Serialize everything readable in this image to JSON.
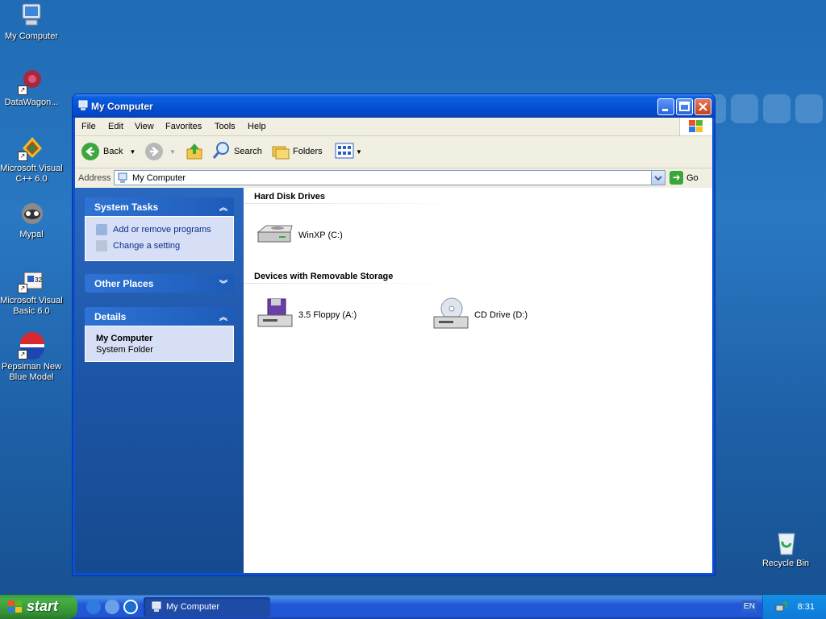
{
  "desktop": {
    "icons": [
      {
        "label": "My Computer"
      },
      {
        "label": "DataWagon..."
      },
      {
        "label": "Microsoft Visual C++ 6.0"
      },
      {
        "label": "Mypal"
      },
      {
        "label": "Microsoft Visual Basic 6.0"
      },
      {
        "label": "Pepsiman New Blue Model"
      },
      {
        "label": "Recycle Bin"
      }
    ]
  },
  "window": {
    "title": "My Computer",
    "menu": [
      "File",
      "Edit",
      "View",
      "Favorites",
      "Tools",
      "Help"
    ],
    "toolbar": {
      "back": "Back",
      "search": "Search",
      "folders": "Folders"
    },
    "address": {
      "label": "Address",
      "value": "My Computer",
      "go": "Go"
    },
    "left_pane": {
      "system_tasks": {
        "title": "System Tasks",
        "links": [
          "Add or remove programs",
          "Change a setting"
        ]
      },
      "other_places": {
        "title": "Other Places"
      },
      "details": {
        "title": "Details",
        "name": "My Computer",
        "type": "System Folder"
      }
    },
    "groups": [
      {
        "title": "Hard Disk Drives",
        "items": [
          {
            "label": "WinXP (C:)",
            "icon": "hard-drive-icon"
          }
        ]
      },
      {
        "title": "Devices with Removable Storage",
        "items": [
          {
            "label": "3.5 Floppy (A:)",
            "icon": "floppy-drive-icon"
          },
          {
            "label": "CD Drive (D:)",
            "icon": "cd-drive-icon"
          }
        ]
      }
    ]
  },
  "taskbar": {
    "start_label": "start",
    "task_button": "My Computer",
    "language": "EN",
    "clock": "8:31"
  }
}
